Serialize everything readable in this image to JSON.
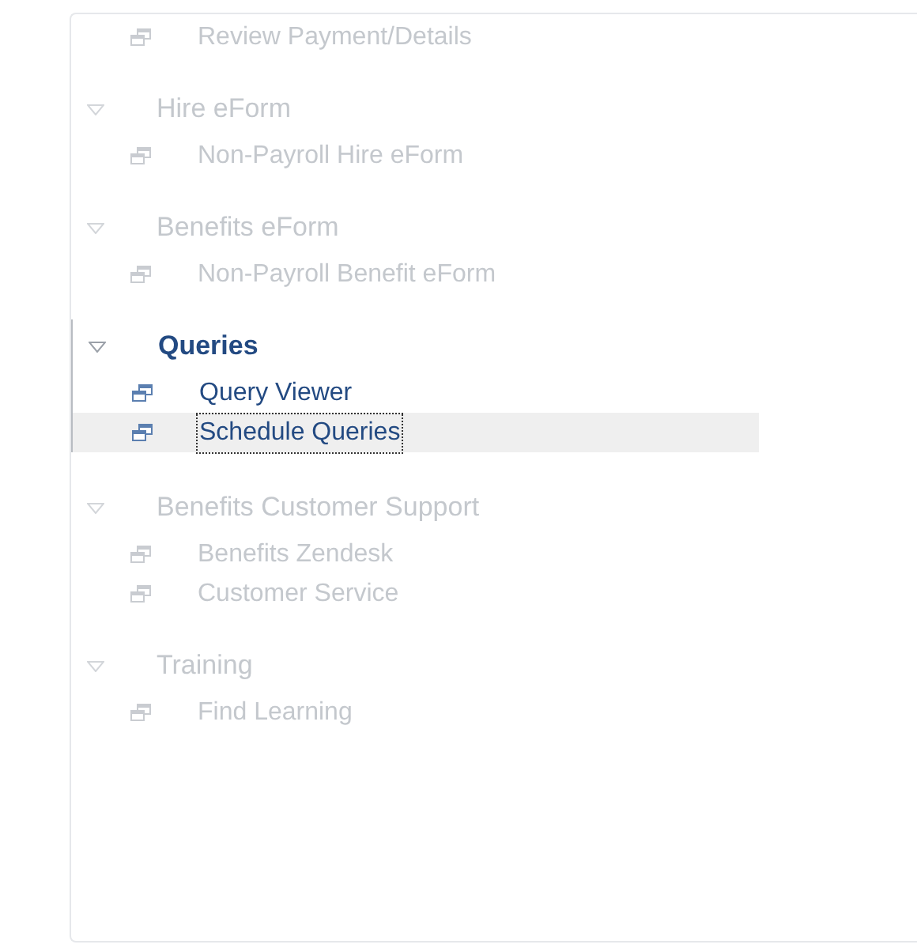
{
  "sections": [
    {
      "dimmed": true,
      "items": [
        {
          "label": "Review Payment/Details",
          "selected": false
        }
      ]
    },
    {
      "header": "Hire eForm",
      "dimmed": true,
      "expanded": true,
      "items": [
        {
          "label": "Non-Payroll Hire eForm",
          "selected": false
        }
      ]
    },
    {
      "header": "Benefits eForm",
      "dimmed": true,
      "expanded": true,
      "items": [
        {
          "label": "Non-Payroll Benefit eForm",
          "selected": false
        }
      ]
    },
    {
      "header": "Queries",
      "dimmed": false,
      "expanded": true,
      "items": [
        {
          "label": "Query Viewer",
          "selected": false
        },
        {
          "label": "Schedule Queries",
          "selected": true
        }
      ]
    },
    {
      "header": "Benefits Customer Support",
      "dimmed": true,
      "expanded": true,
      "items": [
        {
          "label": "Benefits Zendesk",
          "selected": false
        },
        {
          "label": "Customer Service",
          "selected": false
        }
      ]
    },
    {
      "header": "Training",
      "dimmed": true,
      "expanded": true,
      "items": [
        {
          "label": "Find Learning",
          "selected": false
        }
      ]
    }
  ]
}
